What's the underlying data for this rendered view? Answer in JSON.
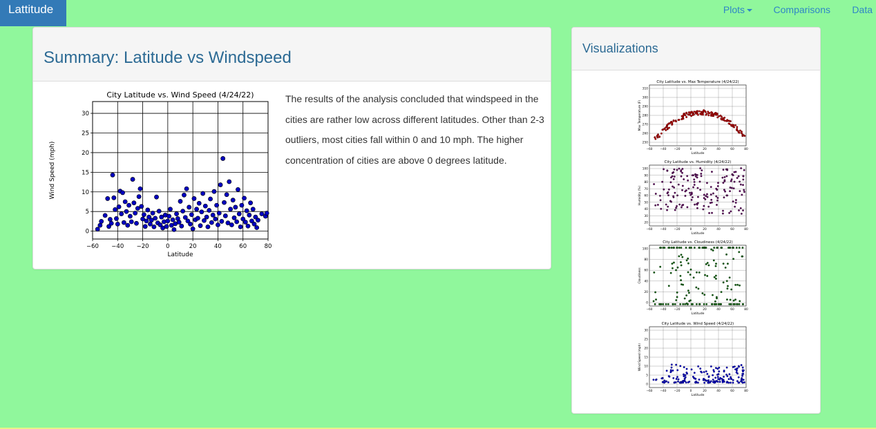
{
  "navbar": {
    "brand": "Lattitude",
    "links": [
      {
        "label": "Plots",
        "dropdown": true
      },
      {
        "label": "Comparisons"
      },
      {
        "label": "Data"
      }
    ]
  },
  "summary": {
    "title": "Summary: Latitude vs Windspeed",
    "text": "The results of the analysis concluded that windspeed in the cities are rather low across different latitudes. Other than 2-3 outliers, most cities fall within 0 and 10 mph. The higher concentration of cities are above 0 degrees latitude."
  },
  "visualizations": {
    "title": "Visualizations",
    "thumbnails": [
      {
        "title": "City Latitude vs. Max Temperature (4/24/22)",
        "xlabel": "Latitude",
        "ylabel": "Max Temperature (F)",
        "color": "#b00000",
        "y_ticks": [
          "310",
          "300",
          "290",
          "280",
          "270",
          "260",
          "250"
        ]
      },
      {
        "title": "City Latitude vs. Humidity (4/24/22)",
        "xlabel": "Latitude",
        "ylabel": "Humidity (%)",
        "color": "#5a0a5a",
        "y_ticks": [
          "100",
          "90",
          "80",
          "70",
          "60",
          "50",
          "40",
          "30",
          "20"
        ]
      },
      {
        "title": "City Latitude vs. Cloudiness (4/24/22)",
        "xlabel": "Latitude",
        "ylabel": "Cloudiness",
        "color": "#0f5f0f",
        "y_ticks": [
          "100",
          "80",
          "60",
          "40",
          "20",
          "0"
        ]
      },
      {
        "title": "City Latitude vs. Wind Speed (4/24/22)",
        "xlabel": "Latitude",
        "ylabel": "Wind Speed (mph)",
        "color": "#0000c0",
        "y_ticks": [
          "30",
          "25",
          "20",
          "15",
          "10",
          "5",
          "0"
        ]
      }
    ],
    "x_ticks": [
      "−60",
      "−40",
      "−20",
      "0",
      "20",
      "40",
      "60",
      "80"
    ]
  },
  "chart_data": {
    "type": "scatter",
    "title": "City Latitude vs. Wind Speed (4/24/22)",
    "xlabel": "Latitude",
    "ylabel": "Wind Speed (mph)",
    "xlim": [
      -60,
      80
    ],
    "ylim": [
      -2,
      33
    ],
    "x_ticks": [
      -60,
      -40,
      -20,
      0,
      20,
      40,
      60,
      80
    ],
    "x_tick_labels": [
      "−60",
      "−40",
      "−20",
      "0",
      "20",
      "40",
      "60",
      "80"
    ],
    "y_ticks": [
      0,
      5,
      10,
      15,
      20,
      25,
      30
    ],
    "grid": true,
    "color": "#0000c0",
    "points": [
      [
        -56,
        0.5
      ],
      [
        -54,
        1.5
      ],
      [
        -53,
        2.5
      ],
      [
        -50,
        4
      ],
      [
        -48,
        8.3
      ],
      [
        -47,
        1.2
      ],
      [
        -46,
        3
      ],
      [
        -45,
        2
      ],
      [
        -44,
        14.3
      ],
      [
        -43,
        8.5
      ],
      [
        -42,
        5.5
      ],
      [
        -41,
        3.2
      ],
      [
        -40,
        1.8
      ],
      [
        -39,
        6.2
      ],
      [
        -38,
        10.2
      ],
      [
        -37,
        4.4
      ],
      [
        -36,
        9.8
      ],
      [
        -35,
        2.2
      ],
      [
        -34,
        7.5
      ],
      [
        -33,
        5
      ],
      [
        -32,
        1.5
      ],
      [
        -31,
        6.6
      ],
      [
        -30,
        3.8
      ],
      [
        -29,
        2.4
      ],
      [
        -28,
        13.2
      ],
      [
        -27,
        7.2
      ],
      [
        -26,
        4.6
      ],
      [
        -25,
        2
      ],
      [
        -24,
        5.8
      ],
      [
        -23,
        8.8
      ],
      [
        -22,
        10.8
      ],
      [
        -21,
        6.3
      ],
      [
        -20,
        3.1
      ],
      [
        -19,
        4.2
      ],
      [
        -18,
        1.2
      ],
      [
        -17,
        2.6
      ],
      [
        -16,
        5.4
      ],
      [
        -15,
        3.6
      ],
      [
        -14,
        1.8
      ],
      [
        -13,
        2.8
      ],
      [
        -12,
        4.6
      ],
      [
        -11,
        1.1
      ],
      [
        -10,
        3.3
      ],
      [
        -9,
        8.7
      ],
      [
        -8,
        2.1
      ],
      [
        -7,
        5.1
      ],
      [
        -6,
        1.6
      ],
      [
        -5,
        3.6
      ],
      [
        -4,
        0.8
      ],
      [
        -3,
        2.4
      ],
      [
        -2,
        4.1
      ],
      [
        -1,
        1.2
      ],
      [
        0,
        2.6
      ],
      [
        1,
        3.8
      ],
      [
        2,
        5.6
      ],
      [
        3,
        1.5
      ],
      [
        4,
        2.9
      ],
      [
        5,
        0.4
      ],
      [
        6,
        1.9
      ],
      [
        7,
        4.4
      ],
      [
        8,
        3.2
      ],
      [
        9,
        2.3
      ],
      [
        10,
        7.6
      ],
      [
        11,
        1.3
      ],
      [
        12,
        5.1
      ],
      [
        13,
        9.2
      ],
      [
        14,
        3.5
      ],
      [
        15,
        10.8
      ],
      [
        16,
        2.6
      ],
      [
        17,
        6.1
      ],
      [
        18,
        1.8
      ],
      [
        19,
        4.2
      ],
      [
        20,
        0.6
      ],
      [
        21,
        8.3
      ],
      [
        22,
        2.9
      ],
      [
        23,
        5.6
      ],
      [
        24,
        3.3
      ],
      [
        25,
        7.1
      ],
      [
        26,
        1.4
      ],
      [
        27,
        4.9
      ],
      [
        28,
        9.6
      ],
      [
        29,
        2.7
      ],
      [
        30,
        6.4
      ],
      [
        31,
        3.6
      ],
      [
        32,
        1.1
      ],
      [
        33,
        5.3
      ],
      [
        34,
        8.2
      ],
      [
        35,
        2.2
      ],
      [
        36,
        4.1
      ],
      [
        37,
        10.1
      ],
      [
        38,
        3.1
      ],
      [
        39,
        6.6
      ],
      [
        40,
        1.6
      ],
      [
        41,
        4.6
      ],
      [
        42,
        11.8
      ],
      [
        43,
        2.5
      ],
      [
        44,
        18.5
      ],
      [
        45,
        7.3
      ],
      [
        46,
        3.9
      ],
      [
        47,
        9.3
      ],
      [
        48,
        2.1
      ],
      [
        49,
        12.6
      ],
      [
        50,
        5.6
      ],
      [
        51,
        1.6
      ],
      [
        52,
        7.9
      ],
      [
        53,
        3.4
      ],
      [
        54,
        6.1
      ],
      [
        55,
        2.4
      ],
      [
        56,
        10.6
      ],
      [
        57,
        4.4
      ],
      [
        58,
        1.1
      ],
      [
        59,
        6.6
      ],
      [
        60,
        3.1
      ],
      [
        61,
        8.4
      ],
      [
        62,
        2.3
      ],
      [
        63,
        5.2
      ],
      [
        64,
        1.3
      ],
      [
        65,
        4.1
      ],
      [
        66,
        7.2
      ],
      [
        67,
        2.6
      ],
      [
        68,
        5.6
      ],
      [
        69,
        1.8
      ],
      [
        70,
        3.6
      ],
      [
        71,
        0.9
      ],
      [
        72,
        2.8
      ],
      [
        75,
        4.4
      ],
      [
        78,
        3.8
      ],
      [
        79,
        4.6
      ]
    ]
  }
}
